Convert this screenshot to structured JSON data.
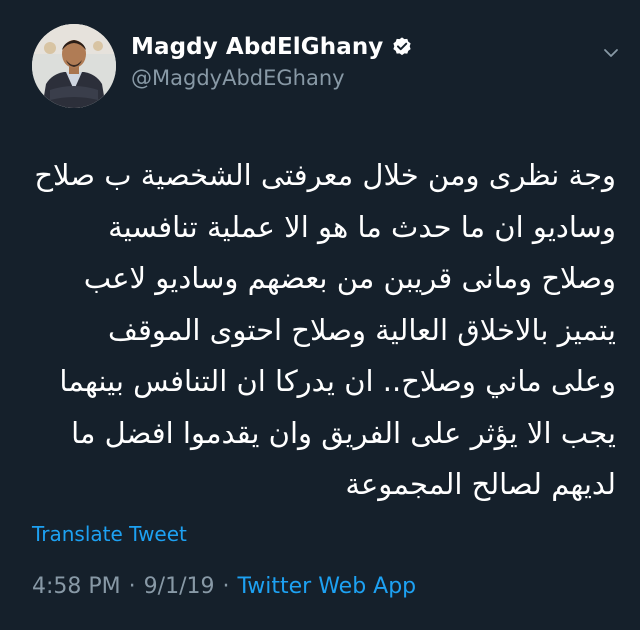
{
  "author": {
    "display_name": "Magdy AbdElGhany",
    "handle": "@MagdyAbdEGhany",
    "verified_icon": "verified-badge-icon",
    "menu_icon": "chevron-down-icon"
  },
  "tweet": {
    "text": "وجة نظرى ومن خلال معرفتى الشخصية ب صلاح\nوساديو ان ما حدث ما هو الا عملية تنافسية\nوصلاح ومانى قريبن من بعضهم وساديو لاعب\nيتميز بالاخلاق العالية وصلاح احتوى الموقف\nوعلى ماني وصلاح.. ان يدركا ان التنافس بينهما\nيجب الا يؤثر على الفريق وان يقدموا افضل ما\nلديهم لصالح المجموعة",
    "translate_label": "Translate Tweet"
  },
  "meta": {
    "time": "4:58 PM",
    "date": "9/1/19",
    "separator": "·",
    "source": "Twitter Web App"
  },
  "colors": {
    "background": "#15202b",
    "link": "#1da1f2",
    "secondary_text": "#8899a6"
  }
}
